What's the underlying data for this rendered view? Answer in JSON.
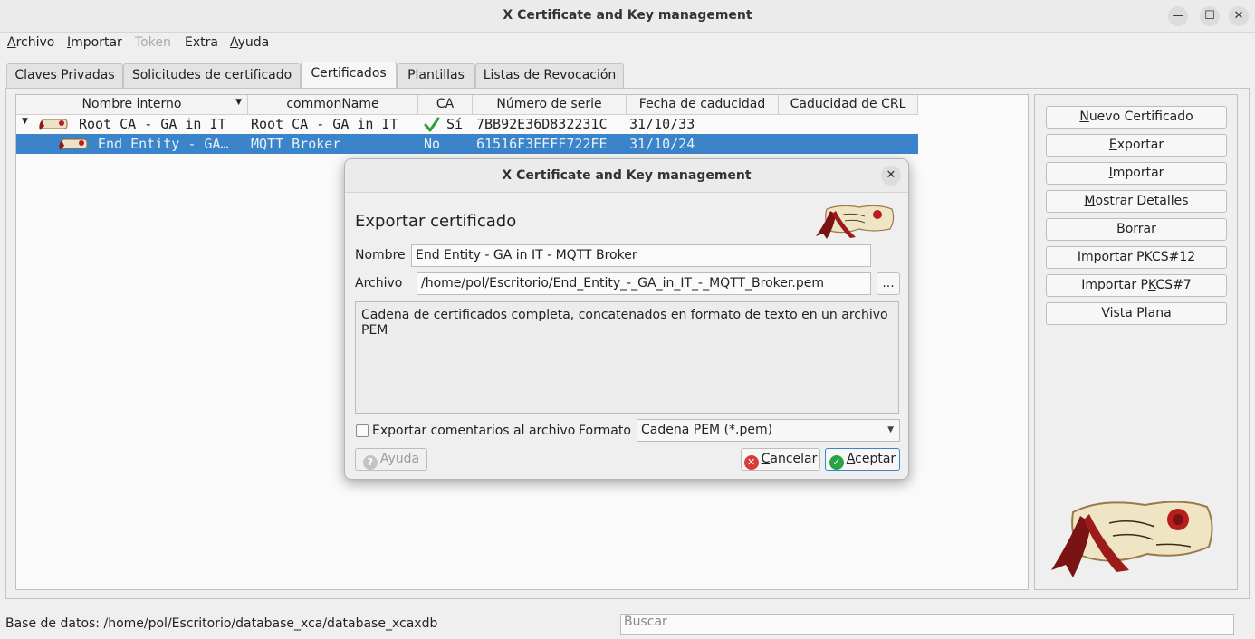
{
  "window": {
    "title": "X Certificate and Key management"
  },
  "menu": [
    {
      "label": "Archivo",
      "mnemonic": "A",
      "rest": "rchivo",
      "enabled": true
    },
    {
      "label": "Importar",
      "mnemonic": "I",
      "rest": "mportar",
      "enabled": true
    },
    {
      "label": "Token",
      "enabled": false
    },
    {
      "label": "Extra",
      "enabled": true
    },
    {
      "label": "Ayuda",
      "mnemonic": "A",
      "rest": "yuda",
      "enabled": true
    }
  ],
  "tabs": [
    {
      "label": "Claves Privadas"
    },
    {
      "label": "Solicitudes de certificado"
    },
    {
      "label": "Certificados",
      "active": true
    },
    {
      "label": "Plantillas"
    },
    {
      "label": "Listas de Revocación"
    }
  ],
  "table": {
    "columns": [
      "Nombre interno",
      "commonName",
      "CA",
      "Número de serie",
      "Fecha de caducidad",
      "Caducidad de CRL"
    ],
    "rows": [
      {
        "name": "Root CA - GA in IT",
        "common_name": "Root CA - GA in IT",
        "ca": "Sí",
        "serial": "7BB92E36D832231C",
        "expiry": "31/10/33",
        "crl": ""
      },
      {
        "name": "End Entity - GA…",
        "common_name": "MQTT Broker",
        "ca": "No",
        "serial": "61516F3EEFF722FE",
        "expiry": "31/10/24",
        "crl": ""
      }
    ]
  },
  "actions": [
    {
      "label": "Nuevo Certificado",
      "mn": "N",
      "pre": "",
      "post": "uevo Certificado"
    },
    {
      "label": "Exportar",
      "mn": "E",
      "pre": "",
      "post": "xportar"
    },
    {
      "label": "Importar",
      "mn": "I",
      "pre": "",
      "post": "mportar"
    },
    {
      "label": "Mostrar Detalles",
      "mn": "M",
      "pre": "",
      "post": "ostrar Detalles"
    },
    {
      "label": "Borrar",
      "mn": "B",
      "pre": "",
      "post": "orrar"
    },
    {
      "label": "Importar PKCS#12",
      "mn": "P",
      "pre": "Importar ",
      "post": "KCS#12"
    },
    {
      "label": "Importar PKCS#7",
      "mn": "K",
      "pre": "Importar P",
      "post": "CS#7"
    },
    {
      "label": "Vista Plana",
      "mn": "",
      "pre": "Vista Plana",
      "post": ""
    }
  ],
  "statusbar": {
    "database": "Base de datos: /home/pol/Escritorio/database_xca/database_xcaxdb",
    "search_placeholder": "Buscar"
  },
  "dialog": {
    "title": "X Certificate and Key management",
    "heading": "Exportar certificado",
    "name_label": "Nombre",
    "name_value": "End Entity - GA in IT - MQTT Broker",
    "file_label": "Archivo",
    "file_value": "/home/pol/Escritorio/End_Entity_-_GA_in_IT_-_MQTT_Broker.pem",
    "browse_label": "...",
    "description": "Cadena de certificados completa, concatenados en formato de texto  en un archivo PEM",
    "export_comments_label": "Exportar comentarios al archivo",
    "export_comments_checked": false,
    "format_label": "Formato",
    "format_value": "Cadena PEM (*.pem)",
    "help_label": "Ayuda",
    "cancel_label": "Cancelar",
    "cancel_rest": "ancelar",
    "accept_label": "Aceptar",
    "accept_rest": "ceptar"
  },
  "colors": {
    "selection": "#3c84c9",
    "check_green": "#2e9e3a",
    "cancel_red": "#d93a3a",
    "accept_green": "#2aa24a",
    "logo_red": "#8b1a1a"
  }
}
